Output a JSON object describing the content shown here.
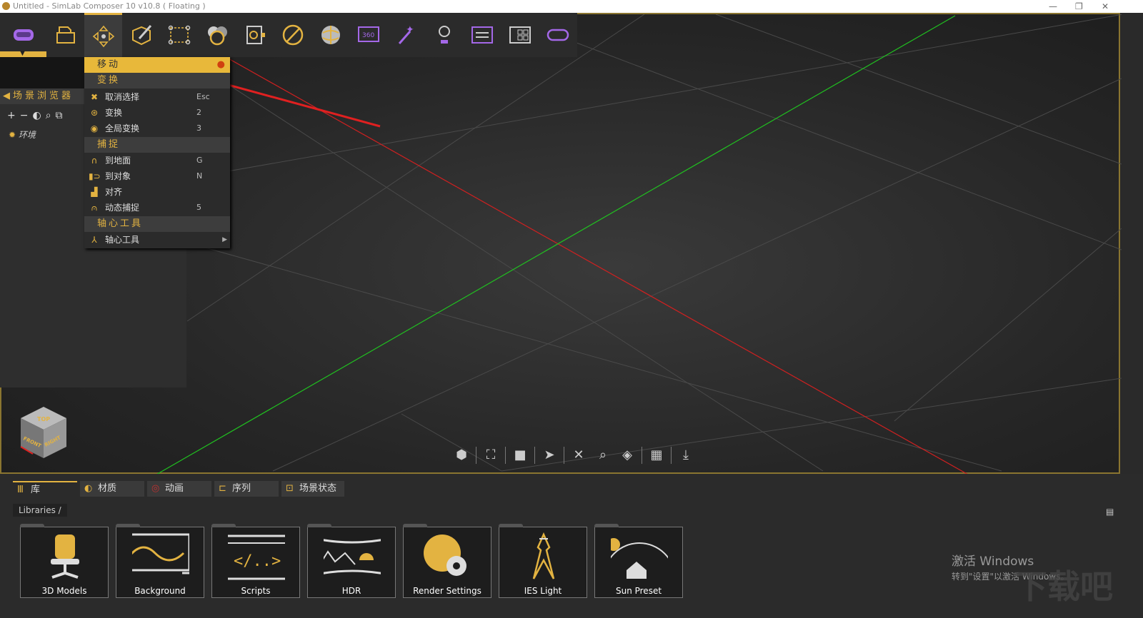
{
  "window": {
    "title": "Untitled - SimLab Composer 10 v10.8 ( Floating )",
    "controls": [
      "—",
      "❐",
      "✕"
    ]
  },
  "toolbar": {
    "items": [
      "vr-viewer",
      "open-file",
      "move",
      "edit-object",
      "select-region",
      "materials",
      "scene-states",
      "color-picker",
      "environment",
      "360-render",
      "effects",
      "lighting",
      "sequence",
      "layout",
      "vr"
    ],
    "active": "move"
  },
  "accent": "#e3b341",
  "scene_browser": {
    "title": "场景浏览器",
    "tools": [
      "+",
      "−",
      "◐",
      "⌕",
      "⧉"
    ],
    "env_label": "环境"
  },
  "menu": {
    "selected": "移动",
    "sections": [
      {
        "title": "变换",
        "items": [
          {
            "label": "取消选择",
            "shortcut": "Esc",
            "icon": "close-icon"
          },
          {
            "label": "变换",
            "shortcut": "2",
            "icon": "transform-icon"
          },
          {
            "label": "全局变换",
            "shortcut": "3",
            "icon": "global-transform-icon"
          }
        ]
      },
      {
        "title": "捕捉",
        "items": [
          {
            "label": "到地面",
            "shortcut": "G",
            "icon": "snap-ground-icon"
          },
          {
            "label": "到对象",
            "shortcut": "N",
            "icon": "snap-object-icon"
          },
          {
            "label": "对齐",
            "shortcut": "",
            "icon": "align-icon"
          },
          {
            "label": "动态捕捉",
            "shortcut": "5",
            "icon": "dynamic-snap-icon"
          }
        ]
      },
      {
        "title": "轴心工具",
        "items": [
          {
            "label": "轴心工具",
            "shortcut": "",
            "icon": "pivot-icon"
          }
        ]
      }
    ]
  },
  "navcube": {
    "top": "TOP",
    "front": "FRONT",
    "right": "RIGHT"
  },
  "bottom": {
    "tabs": [
      "库",
      "材质",
      "动画",
      "序列",
      "场景状态"
    ],
    "breadcrumb": "Libraries  /",
    "libraries": [
      "3D Models",
      "Background",
      "Scripts",
      "HDR",
      "Render Settings",
      "IES Light",
      "Sun Preset"
    ]
  },
  "watermark": {
    "line1": "激活 Windows",
    "line2": "转到\"设置\"以激活 Windows。",
    "site": "下载吧"
  }
}
